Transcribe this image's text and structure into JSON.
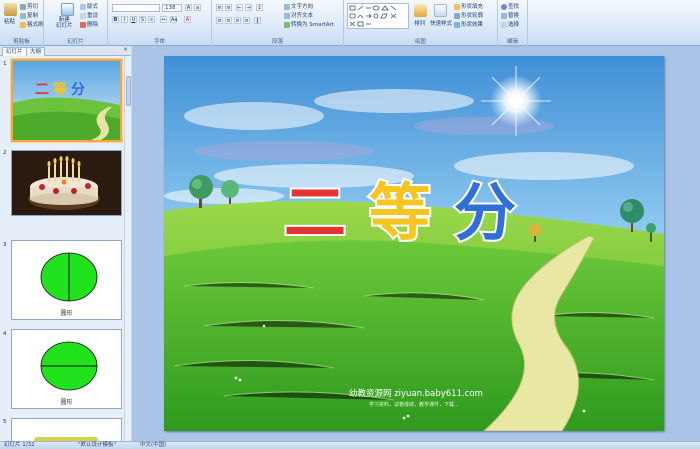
{
  "ribbon": {
    "clipboard": {
      "label": "剪贴板",
      "paste": "粘贴",
      "cut": "剪切",
      "copy": "复制",
      "format_painter": "格式刷"
    },
    "slides": {
      "label": "幻灯片",
      "new_slide": "新建\n幻灯片",
      "layout": "版式",
      "reset": "重设",
      "delete": "删除"
    },
    "font": {
      "label": "字体",
      "font_name": "",
      "font_size": "138"
    },
    "paragraph": {
      "label": "段落",
      "text_direction": "文字方向",
      "align_text": "对齐文本",
      "smartart": "转换为 SmartArt"
    },
    "drawing": {
      "label": "绘图",
      "arrange": "排列",
      "quick_styles": "快速样式",
      "shape_fill": "形状填充",
      "shape_outline": "形状轮廓",
      "shape_effects": "形状效果"
    },
    "editing": {
      "label": "编辑",
      "find": "查找",
      "replace": "替换",
      "select": "选择"
    }
  },
  "panel": {
    "tabs": [
      "幻灯片",
      "大纲"
    ],
    "slides": [
      {
        "number": "1",
        "caption": "",
        "title": "二等分"
      },
      {
        "number": "2",
        "caption": ""
      },
      {
        "number": "3",
        "caption": "圆形"
      },
      {
        "number": "4",
        "caption": "圆形"
      },
      {
        "number": "5",
        "caption": ""
      }
    ]
  },
  "slide": {
    "title_chars": [
      "二",
      "等",
      "分"
    ],
    "watermark": "幼教资源网 ziyuan.baby611.com",
    "watermark_sub": "学习资料，试卷成绩，教学课件，下载..."
  },
  "status": {
    "slide_counter": "幻灯片 1/32",
    "theme": "\"默认设计模板\"",
    "language": "中文(中国)"
  },
  "colors": {
    "accent": "#15428b",
    "selection": "#f5a63c",
    "title_red": "#e3342f",
    "title_yellow": "#f6c522",
    "title_blue": "#2f6fd6",
    "circle_green": "#22e11d"
  }
}
